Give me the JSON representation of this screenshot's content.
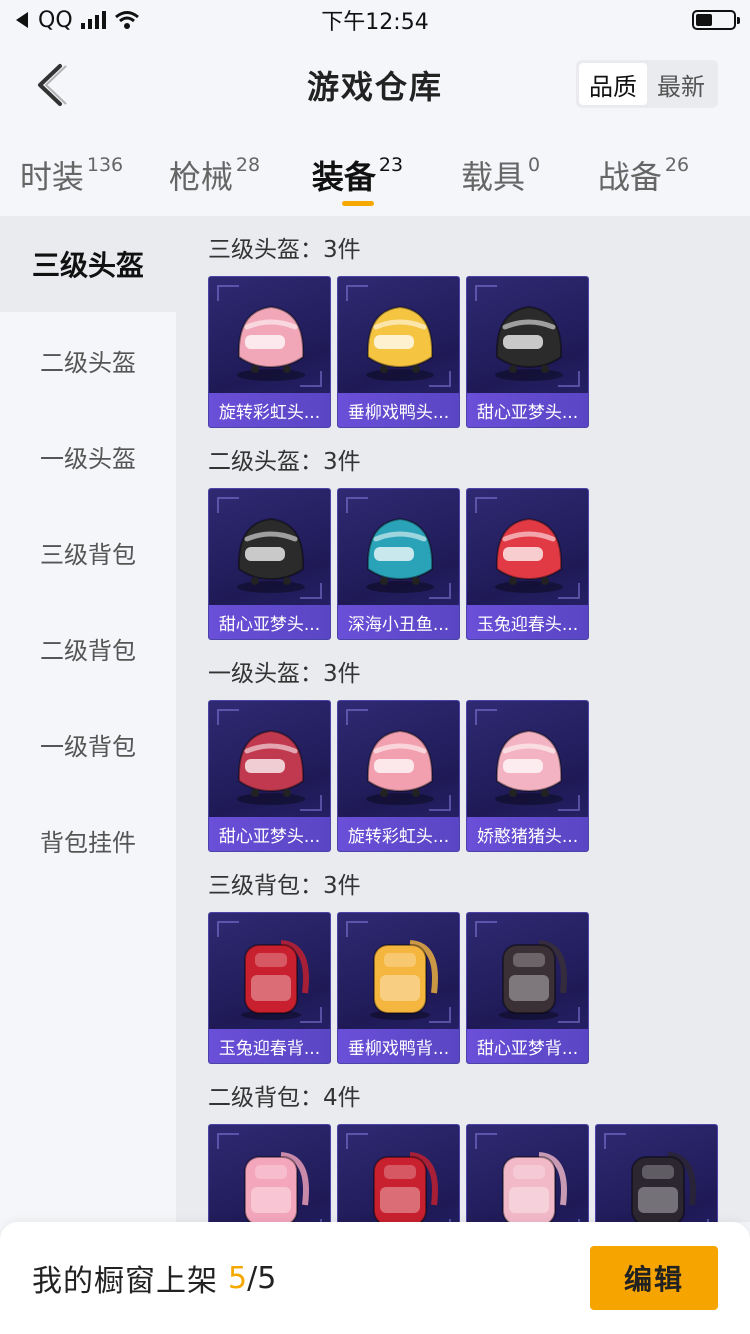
{
  "status_bar": {
    "carrier": "QQ",
    "time": "下午12:54"
  },
  "header": {
    "title": "游戏仓库",
    "sort_options": [
      "品质",
      "最新"
    ],
    "sort_active": "品质"
  },
  "tabs": [
    {
      "label": "时装",
      "count": "136"
    },
    {
      "label": "枪械",
      "count": "28"
    },
    {
      "label": "装备",
      "count": "23",
      "active": true
    },
    {
      "label": "载具",
      "count": "0"
    },
    {
      "label": "战备",
      "count": "26"
    }
  ],
  "sidebar": {
    "items": [
      "三级头盔",
      "二级头盔",
      "一级头盔",
      "三级背包",
      "二级背包",
      "一级背包",
      "背包挂件"
    ],
    "active_index": 0
  },
  "sections": [
    {
      "title": "三级头盔：3件",
      "items": [
        {
          "name": "旋转彩虹头...",
          "icon": "helmet-icon",
          "color": "#f2a7b8"
        },
        {
          "name": "垂柳戏鸭头...",
          "icon": "helmet-icon",
          "color": "#f5c542"
        },
        {
          "name": "甜心亚梦头...",
          "icon": "helmet-icon",
          "color": "#2b2b2b"
        }
      ]
    },
    {
      "title": "二级头盔：3件",
      "items": [
        {
          "name": "甜心亚梦头...",
          "icon": "helmet-icon",
          "color": "#2b2b2b"
        },
        {
          "name": "深海小丑鱼...",
          "icon": "helmet-icon",
          "color": "#2aa3b8"
        },
        {
          "name": "玉兔迎春头...",
          "icon": "helmet-icon",
          "color": "#e23a45"
        }
      ]
    },
    {
      "title": "一级头盔：3件",
      "items": [
        {
          "name": "甜心亚梦头...",
          "icon": "helmet-icon",
          "color": "#c0394f"
        },
        {
          "name": "旋转彩虹头...",
          "icon": "helmet-icon",
          "color": "#f2a0b0"
        },
        {
          "name": "娇憨猪猪头...",
          "icon": "helmet-icon",
          "color": "#f4b3c2"
        }
      ]
    },
    {
      "title": "三级背包：3件",
      "items": [
        {
          "name": "玉兔迎春背...",
          "icon": "backpack-icon",
          "color": "#c8202e"
        },
        {
          "name": "垂柳戏鸭背...",
          "icon": "backpack-icon",
          "color": "#f5b63f"
        },
        {
          "name": "甜心亚梦背...",
          "icon": "backpack-icon",
          "color": "#3a3036"
        }
      ]
    },
    {
      "title": "二级背包：4件",
      "items": [
        {
          "name": "",
          "icon": "backpack-icon",
          "color": "#f4a6bd"
        },
        {
          "name": "",
          "icon": "backpack-icon",
          "color": "#c8202e"
        },
        {
          "name": "",
          "icon": "backpack-icon",
          "color": "#f2b9c9"
        },
        {
          "name": "",
          "icon": "backpack-icon",
          "color": "#2b2630"
        }
      ]
    }
  ],
  "bottom_bar": {
    "label": "我的橱窗上架",
    "count": "5",
    "separator": "/",
    "total": "5",
    "edit_label": "编辑"
  },
  "colors": {
    "accent": "#f5a800",
    "card_bg": "#2f2a73",
    "card_label": "#6a4fd8"
  }
}
